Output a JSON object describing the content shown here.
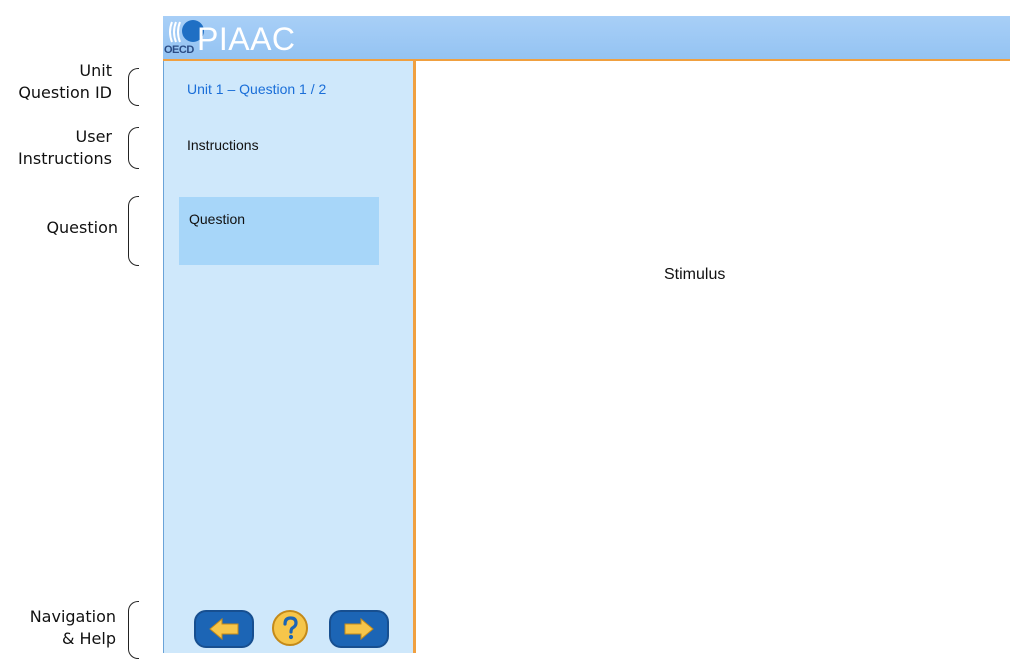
{
  "annotations": {
    "unit_question_id": [
      "Unit",
      "Question ID"
    ],
    "user_instructions": [
      "User",
      "Instructions"
    ],
    "question": [
      "Question"
    ],
    "navigation_help": [
      "Navigation",
      "& Help"
    ]
  },
  "header": {
    "brand": "PIAAC",
    "org": "OECD"
  },
  "sidebar": {
    "question_id": "Unit 1 – Question 1 / 2",
    "instructions": "Instructions",
    "question": "Question"
  },
  "content": {
    "stimulus": "Stimulus"
  },
  "navigation": {
    "prev_icon": "arrow-left-icon",
    "help_icon": "question-mark-icon",
    "next_icon": "arrow-right-icon"
  },
  "colors": {
    "header": "#a8cff7",
    "sidebar": "#cfe8fb",
    "question_highlight": "#a7d6f9",
    "divider": "#f0a040",
    "nav_button": "#1c65b5",
    "nav_arrow": "#f6c64a"
  }
}
